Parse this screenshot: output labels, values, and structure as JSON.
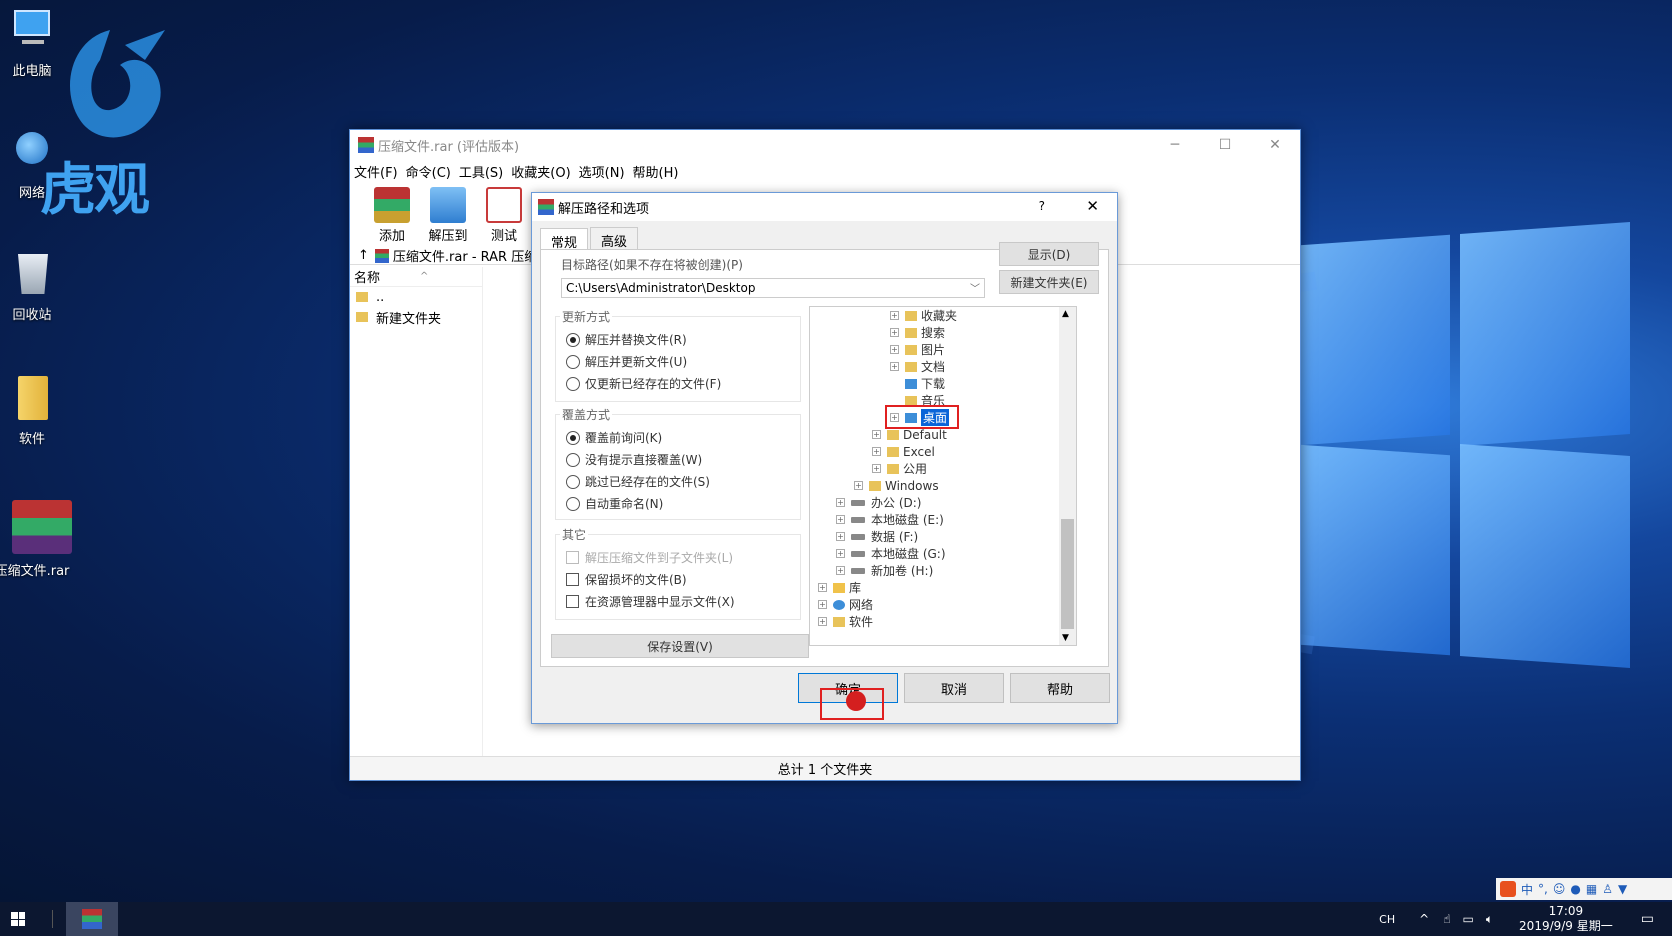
{
  "desktop": {
    "icons": [
      {
        "label": "此电脑"
      },
      {
        "label": "网络"
      },
      {
        "label": "回收站"
      },
      {
        "label": "软件"
      },
      {
        "label": "压缩文件.rar"
      }
    ],
    "watermark_text": "虎观"
  },
  "main_window": {
    "title": "压缩文件.rar (评估版本)",
    "controls": {
      "minimize": "─",
      "maximize": "☐",
      "close": "✕"
    },
    "menu": [
      "文件(F)",
      "命令(C)",
      "工具(S)",
      "收藏夹(O)",
      "选项(N)",
      "帮助(H)"
    ],
    "toolbar": [
      {
        "label": "添加",
        "color": "#c8a030"
      },
      {
        "label": "解压到",
        "color": "#3d8ed8"
      },
      {
        "label": "测试",
        "color": "#c83a3a"
      }
    ],
    "address": "压缩文件.rar - RAR 压缩",
    "up_arrow": "↑",
    "column_name": "名称",
    "sort_arrow": "^",
    "files": [
      {
        "name": ".."
      },
      {
        "name": "新建文件夹"
      }
    ],
    "status": "总计 1 个文件夹"
  },
  "dialog": {
    "title": "解压路径和选项",
    "help": "?",
    "close": "✕",
    "tabs": [
      {
        "label": "常规",
        "active": true
      },
      {
        "label": "高级",
        "active": false
      }
    ],
    "target_label": "目标路径(如果不存在将被创建)(P)",
    "target_value": "C:\\Users\\Administrator\\Desktop",
    "dropdown_arrow": "﹀",
    "show_button": "显示(D)",
    "new_folder_button": "新建文件夹(E)",
    "update_group": {
      "title": "更新方式",
      "options": [
        {
          "label": "解压并替换文件(R)",
          "checked": true
        },
        {
          "label": "解压并更新文件(U)",
          "checked": false
        },
        {
          "label": "仅更新已经存在的文件(F)",
          "checked": false
        }
      ]
    },
    "overwrite_group": {
      "title": "覆盖方式",
      "options": [
        {
          "label": "覆盖前询问(K)",
          "checked": true
        },
        {
          "label": "没有提示直接覆盖(W)",
          "checked": false
        },
        {
          "label": "跳过已经存在的文件(S)",
          "checked": false
        },
        {
          "label": "自动重命名(N)",
          "checked": false
        }
      ]
    },
    "misc_group": {
      "title": "其它",
      "options": [
        {
          "label": "解压压缩文件到子文件夹(L)",
          "checked": false,
          "disabled": true
        },
        {
          "label": "保留损坏的文件(B)",
          "checked": false,
          "disabled": false
        },
        {
          "label": "在资源管理器中显示文件(X)",
          "checked": false,
          "disabled": false
        }
      ]
    },
    "save_button": "保存设置(V)",
    "tree": [
      {
        "label": "收藏夹"
      },
      {
        "label": "搜索"
      },
      {
        "label": "图片"
      },
      {
        "label": "文档"
      },
      {
        "label": "下载"
      },
      {
        "label": "音乐"
      },
      {
        "label": "桌面",
        "selected": true
      },
      {
        "label": "Default"
      },
      {
        "label": "Excel"
      },
      {
        "label": "公用"
      },
      {
        "label": "Windows"
      },
      {
        "label": "办公 (D:)"
      },
      {
        "label": "本地磁盘 (E:)"
      },
      {
        "label": "数据 (F:)"
      },
      {
        "label": "本地磁盘 (G:)"
      },
      {
        "label": "新加卷 (H:)"
      },
      {
        "label": "库"
      },
      {
        "label": "网络"
      },
      {
        "label": "软件"
      }
    ],
    "buttons": {
      "ok": "确定",
      "cancel": "取消",
      "help": "帮助"
    },
    "highlight_color": "#e02020"
  },
  "taskbar": {
    "ime_lang": "CH",
    "ime_mode": "中",
    "time": "17:09",
    "date": "2019/9/9 星期一"
  }
}
